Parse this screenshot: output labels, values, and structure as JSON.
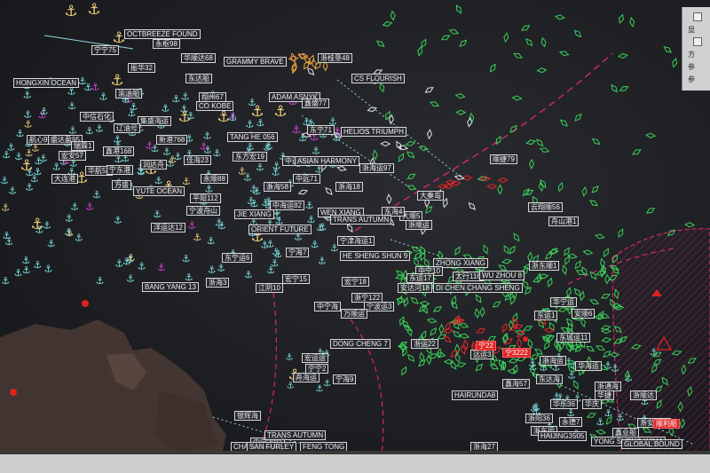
{
  "side_panel": {
    "items": [
      "显",
      "方",
      "参",
      "参"
    ]
  },
  "vessel_labels": [
    {
      "text": "OCTBREEZE FOUND",
      "color": "normal"
    },
    {
      "text": "永枢98",
      "color": "normal"
    },
    {
      "text": "宁宁75",
      "color": "normal"
    },
    {
      "text": "华顺达68",
      "color": "normal"
    },
    {
      "text": "GRAMMY BRAVE",
      "color": "normal"
    },
    {
      "text": "浙桂垦48",
      "color": "normal"
    },
    {
      "text": "振华32",
      "color": "normal"
    },
    {
      "text": "HONGXIN OCEAN",
      "color": "normal"
    },
    {
      "text": "东达船",
      "color": "normal"
    },
    {
      "text": "CS FLOURISH",
      "color": "normal"
    },
    {
      "text": "渝油船",
      "color": "normal"
    },
    {
      "text": "翔州67",
      "color": "normal"
    },
    {
      "text": "ADAM ASNYK",
      "color": "normal"
    },
    {
      "text": "CO KOBE",
      "color": "normal"
    },
    {
      "text": "鑫盛77",
      "color": "normal"
    },
    {
      "text": "中信石化",
      "color": "normal"
    },
    {
      "text": "集盛海运",
      "color": "normal"
    },
    {
      "text": "辽油号",
      "color": "normal"
    },
    {
      "text": "TANG HE 056",
      "color": "normal"
    },
    {
      "text": "HELIOS TRIUMPH",
      "color": "normal"
    },
    {
      "text": "东宁71",
      "color": "normal"
    },
    {
      "text": "航心99",
      "color": "normal"
    },
    {
      "text": "盛达盈95",
      "color": "normal"
    },
    {
      "text": "瑞霖1",
      "color": "normal"
    },
    {
      "text": "新港768",
      "color": "normal"
    },
    {
      "text": "鑫港168",
      "color": "normal"
    },
    {
      "text": "宏安57",
      "color": "normal"
    },
    {
      "text": "佳海23",
      "color": "normal"
    },
    {
      "text": "润达舟",
      "color": "normal"
    },
    {
      "text": "东方宏19",
      "color": "normal"
    },
    {
      "text": "中远海运",
      "color": "normal"
    },
    {
      "text": "ASIAN HARMONY",
      "color": "normal"
    },
    {
      "text": "浙海运97",
      "color": "normal"
    },
    {
      "text": "顺捷79",
      "color": "normal"
    },
    {
      "text": "华航52",
      "color": "normal"
    },
    {
      "text": "大连港",
      "color": "normal"
    },
    {
      "text": "宁东港",
      "color": "normal"
    },
    {
      "text": "永顺88",
      "color": "normal"
    },
    {
      "text": "中远71",
      "color": "normal"
    },
    {
      "text": "浙海58",
      "color": "normal"
    },
    {
      "text": "浙海18",
      "color": "normal"
    },
    {
      "text": "大秦岛",
      "color": "normal"
    },
    {
      "text": "YUTE OCEAN",
      "color": "normal"
    },
    {
      "text": "万盛",
      "color": "normal"
    },
    {
      "text": "平阳112",
      "color": "normal"
    },
    {
      "text": "中海运82",
      "color": "normal"
    },
    {
      "text": "云翔顺56",
      "color": "normal"
    },
    {
      "text": "舟山港1",
      "color": "normal"
    },
    {
      "text": "JIE XIANG",
      "color": "normal"
    },
    {
      "text": "WEN XIANG",
      "color": "normal"
    },
    {
      "text": "大顺5",
      "color": "normal"
    },
    {
      "text": "东海4",
      "color": "normal"
    },
    {
      "text": "ORIENT FUTURE",
      "color": "normal"
    },
    {
      "text": "TRANS AUTUMN",
      "color": "normal"
    },
    {
      "text": "浙顺运",
      "color": "normal"
    },
    {
      "text": "洋运达12",
      "color": "normal"
    },
    {
      "text": "宁波舟山",
      "color": "normal"
    },
    {
      "text": "宁津海运1",
      "color": "normal"
    },
    {
      "text": "宁海7",
      "color": "normal"
    },
    {
      "text": "HE SHENG SHUN 9",
      "color": "normal"
    },
    {
      "text": "ZHONG XIANG",
      "color": "normal"
    },
    {
      "text": "东宁运6",
      "color": "normal"
    },
    {
      "text": "浙东顺1",
      "color": "normal"
    },
    {
      "text": "中宁10",
      "color": "normal"
    },
    {
      "text": "东运17",
      "color": "normal"
    },
    {
      "text": "太行118",
      "color": "normal"
    },
    {
      "text": "WU ZHOU 8",
      "color": "normal"
    },
    {
      "text": "BANG YANG 13",
      "color": "normal"
    },
    {
      "text": "浙海3",
      "color": "normal"
    },
    {
      "text": "江阴10",
      "color": "normal"
    },
    {
      "text": "宏宁15",
      "color": "normal"
    },
    {
      "text": "宏宁18",
      "color": "normal"
    },
    {
      "text": "安达河18",
      "color": "normal"
    },
    {
      "text": "DI CHEN CHANG SHENG",
      "color": "normal"
    },
    {
      "text": "华宁运",
      "color": "normal"
    },
    {
      "text": "浙宁122",
      "color": "normal"
    },
    {
      "text": "宁波运3",
      "color": "normal"
    },
    {
      "text": "中宁海",
      "color": "normal"
    },
    {
      "text": "万顺运",
      "color": "normal"
    },
    {
      "text": "东运1",
      "color": "normal"
    },
    {
      "text": "安顺6",
      "color": "normal"
    },
    {
      "text": "东城运11",
      "color": "normal"
    },
    {
      "text": "DONG CHENG 7",
      "color": "normal"
    },
    {
      "text": "浙运22",
      "color": "normal"
    },
    {
      "text": "远运3",
      "color": "normal"
    },
    {
      "text": "宁22",
      "color": "red"
    },
    {
      "text": "宁3222",
      "color": "red"
    },
    {
      "text": "宏运运",
      "color": "normal"
    },
    {
      "text": "宁宁2",
      "color": "normal"
    },
    {
      "text": "舟海运",
      "color": "normal"
    },
    {
      "text": "宁海9",
      "color": "normal"
    },
    {
      "text": "浙海运",
      "color": "normal"
    },
    {
      "text": "华海运",
      "color": "normal"
    },
    {
      "text": "鑫海57",
      "color": "normal"
    },
    {
      "text": "浙通海",
      "color": "normal"
    },
    {
      "text": "东达海",
      "color": "normal"
    },
    {
      "text": "HAIRUNDA8",
      "color": "normal"
    },
    {
      "text": "浙阳36",
      "color": "normal"
    },
    {
      "text": "华乐36",
      "color": "normal"
    },
    {
      "text": "华庆",
      "color": "normal"
    },
    {
      "text": "华捷",
      "color": "normal"
    },
    {
      "text": "浙顺达",
      "color": "normal"
    },
    {
      "text": "浙东运",
      "color": "normal"
    },
    {
      "text": "鑫业船",
      "color": "normal"
    },
    {
      "text": "浙安海运",
      "color": "normal"
    },
    {
      "text": "银辉海",
      "color": "normal"
    },
    {
      "text": "HAIJING3505",
      "color": "normal"
    },
    {
      "text": "YONG SHENG WIMA",
      "color": "normal"
    },
    {
      "text": "GLOBAL BOUND",
      "color": "normal"
    },
    {
      "text": "中宁2011",
      "color": "normal"
    },
    {
      "text": "TRANS AUTUMN",
      "color": "normal"
    },
    {
      "text": "CHANGJIANG",
      "color": "normal"
    },
    {
      "text": "SAN FURLEY",
      "color": "normal"
    },
    {
      "text": "FENG TONG",
      "color": "normal"
    },
    {
      "text": "浙海27",
      "color": "normal"
    },
    {
      "text": "顺利船",
      "color": "red"
    },
    {
      "text": "永德7",
      "color": "normal"
    },
    {
      "text": "宁东1",
      "color": "normal"
    }
  ],
  "icons": {
    "anchor_color": "#7fe3e3",
    "anchor_highlight_color": "#f4d27a",
    "anchor_alert_color": "#e040e0",
    "vessel_color": "#3ad05a",
    "alert_vessel_color": "#e82828",
    "boundary_color": "#d0286a"
  }
}
